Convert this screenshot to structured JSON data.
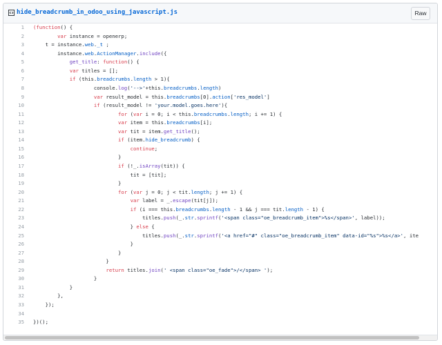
{
  "file": {
    "name": "hide_breadcrumb_in_odoo_using_javascript.js",
    "raw_label": "Raw",
    "icon": "code-file-icon"
  },
  "colors": {
    "keyword": "#d73a49",
    "string": "#032f62",
    "function": "#6f42c1",
    "property": "#005cc5",
    "line_number": "#959da5"
  },
  "lines": [
    {
      "n": "1",
      "tokens": [
        [
          "k",
          "(function"
        ],
        [
          "",
          "() {"
        ]
      ]
    },
    {
      "n": "2",
      "tokens": [
        [
          "",
          "        "
        ],
        [
          "k",
          "var"
        ],
        [
          "",
          " instance = openerp;"
        ]
      ]
    },
    {
      "n": "3",
      "tokens": [
        [
          "",
          "    t = instance."
        ],
        [
          "p",
          "web"
        ],
        [
          "",
          "."
        ],
        [
          "p",
          "_t"
        ],
        [
          "",
          " ;"
        ]
      ]
    },
    {
      "n": "4",
      "tokens": [
        [
          "",
          "        instance."
        ],
        [
          "p",
          "web"
        ],
        [
          "",
          "."
        ],
        [
          "p",
          "ActionManager"
        ],
        [
          "",
          "."
        ],
        [
          "f",
          "include"
        ],
        [
          "",
          "({"
        ]
      ]
    },
    {
      "n": "5",
      "tokens": [
        [
          "",
          "            "
        ],
        [
          "f",
          "get_title"
        ],
        [
          "",
          ": "
        ],
        [
          "k",
          "function"
        ],
        [
          "",
          "() {"
        ]
      ]
    },
    {
      "n": "6",
      "tokens": [
        [
          "",
          "            "
        ],
        [
          "k",
          "var"
        ],
        [
          "",
          " titles = [];"
        ]
      ]
    },
    {
      "n": "7",
      "tokens": [
        [
          "",
          "            "
        ],
        [
          "k",
          "if"
        ],
        [
          "",
          " (this."
        ],
        [
          "p",
          "breadcrumbs"
        ],
        [
          "",
          "."
        ],
        [
          "p",
          "length"
        ],
        [
          "",
          " > 1){"
        ]
      ]
    },
    {
      "n": "8",
      "tokens": [
        [
          "",
          "                    console."
        ],
        [
          "f",
          "log"
        ],
        [
          "",
          "("
        ],
        [
          "s",
          "'-->'"
        ],
        [
          "",
          "+this."
        ],
        [
          "p",
          "breadcrumbs"
        ],
        [
          "",
          "."
        ],
        [
          "p",
          "length"
        ],
        [
          "",
          ")"
        ]
      ]
    },
    {
      "n": "9",
      "tokens": [
        [
          "",
          "                    "
        ],
        [
          "k",
          "var"
        ],
        [
          "",
          " result_model = this."
        ],
        [
          "p",
          "breadcrumbs"
        ],
        [
          "",
          "[0]."
        ],
        [
          "p",
          "action"
        ],
        [
          "",
          "["
        ],
        [
          "s",
          "'res_model'"
        ],
        [
          "",
          "]"
        ]
      ]
    },
    {
      "n": "10",
      "tokens": [
        [
          "",
          "                    "
        ],
        [
          "k",
          "if"
        ],
        [
          "",
          " (result_model != "
        ],
        [
          "s",
          "'your.model.goes.here'"
        ],
        [
          "",
          "){"
        ]
      ]
    },
    {
      "n": "11",
      "tokens": [
        [
          "",
          "                            "
        ],
        [
          "k",
          "for"
        ],
        [
          "",
          " ("
        ],
        [
          "k",
          "var"
        ],
        [
          "",
          " i = 0; i < this."
        ],
        [
          "p",
          "breadcrumbs"
        ],
        [
          "",
          "."
        ],
        [
          "p",
          "length"
        ],
        [
          "",
          "; i += 1) {"
        ]
      ]
    },
    {
      "n": "12",
      "tokens": [
        [
          "",
          "                            "
        ],
        [
          "k",
          "var"
        ],
        [
          "",
          " item = this."
        ],
        [
          "p",
          "breadcrumbs"
        ],
        [
          "",
          "[i];"
        ]
      ]
    },
    {
      "n": "13",
      "tokens": [
        [
          "",
          "                            "
        ],
        [
          "k",
          "var"
        ],
        [
          "",
          " tit = item."
        ],
        [
          "f",
          "get_title"
        ],
        [
          "",
          "();"
        ]
      ]
    },
    {
      "n": "14",
      "tokens": [
        [
          "",
          "                            "
        ],
        [
          "k",
          "if"
        ],
        [
          "",
          " (item."
        ],
        [
          "p",
          "hide_breadcrumb"
        ],
        [
          "",
          ") {"
        ]
      ]
    },
    {
      "n": "15",
      "tokens": [
        [
          "",
          "                                "
        ],
        [
          "k",
          "continue"
        ],
        [
          "",
          ";"
        ]
      ]
    },
    {
      "n": "16",
      "tokens": [
        [
          "",
          "                            }"
        ]
      ]
    },
    {
      "n": "17",
      "tokens": [
        [
          "",
          "                            "
        ],
        [
          "k",
          "if"
        ],
        [
          "",
          " (!_."
        ],
        [
          "f",
          "isArray"
        ],
        [
          "",
          "(tit)) {"
        ]
      ]
    },
    {
      "n": "18",
      "tokens": [
        [
          "",
          "                                tit = [tit];"
        ]
      ]
    },
    {
      "n": "19",
      "tokens": [
        [
          "",
          "                            }"
        ]
      ]
    },
    {
      "n": "20",
      "tokens": [
        [
          "",
          "                            "
        ],
        [
          "k",
          "for"
        ],
        [
          "",
          " ("
        ],
        [
          "k",
          "var"
        ],
        [
          "",
          " j = 0; j < tit."
        ],
        [
          "p",
          "length"
        ],
        [
          "",
          "; j += 1) {"
        ]
      ]
    },
    {
      "n": "21",
      "tokens": [
        [
          "",
          "                                "
        ],
        [
          "k",
          "var"
        ],
        [
          "",
          " label = _."
        ],
        [
          "f",
          "escape"
        ],
        [
          "",
          "(tit[j]);"
        ]
      ]
    },
    {
      "n": "22",
      "tokens": [
        [
          "",
          "                                "
        ],
        [
          "k",
          "if"
        ],
        [
          "",
          " (i === this."
        ],
        [
          "p",
          "breadcrumbs"
        ],
        [
          "",
          "."
        ],
        [
          "p",
          "length"
        ],
        [
          "",
          " - 1 && j === tit."
        ],
        [
          "p",
          "length"
        ],
        [
          "",
          " - 1) {"
        ]
      ]
    },
    {
      "n": "23",
      "tokens": [
        [
          "",
          "                                    titles."
        ],
        [
          "f",
          "push"
        ],
        [
          "",
          "(_."
        ],
        [
          "p",
          "str"
        ],
        [
          "",
          "."
        ],
        [
          "f",
          "sprintf"
        ],
        [
          "",
          "("
        ],
        [
          "s",
          "'<span class=\"oe_breadcrumb_item\">%s</span>'"
        ],
        [
          "",
          ", label));"
        ]
      ]
    },
    {
      "n": "24",
      "tokens": [
        [
          "",
          "                                } "
        ],
        [
          "k",
          "else"
        ],
        [
          "",
          " {"
        ]
      ]
    },
    {
      "n": "25",
      "tokens": [
        [
          "",
          "                                    titles."
        ],
        [
          "f",
          "push"
        ],
        [
          "",
          "(_."
        ],
        [
          "p",
          "str"
        ],
        [
          "",
          "."
        ],
        [
          "f",
          "sprintf"
        ],
        [
          "",
          "("
        ],
        [
          "s",
          "'<a href=\"#\" class=\"oe_breadcrumb_item\" data-id=\"%s\">%s</a>'"
        ],
        [
          "",
          ", ite"
        ]
      ]
    },
    {
      "n": "26",
      "tokens": [
        [
          "",
          "                                }"
        ]
      ]
    },
    {
      "n": "27",
      "tokens": [
        [
          "",
          "                            }"
        ]
      ]
    },
    {
      "n": "28",
      "tokens": [
        [
          "",
          "                        }"
        ]
      ]
    },
    {
      "n": "29",
      "tokens": [
        [
          "",
          "                        "
        ],
        [
          "k",
          "return"
        ],
        [
          "",
          " titles."
        ],
        [
          "f",
          "join"
        ],
        [
          "",
          "("
        ],
        [
          "s",
          "' <span class=\"oe_fade\">/</span> '"
        ],
        [
          "",
          ");"
        ]
      ]
    },
    {
      "n": "30",
      "tokens": [
        [
          "",
          "                    }"
        ]
      ]
    },
    {
      "n": "31",
      "tokens": [
        [
          "",
          "            }"
        ]
      ]
    },
    {
      "n": "32",
      "tokens": [
        [
          "",
          "        },"
        ]
      ]
    },
    {
      "n": "33",
      "tokens": [
        [
          "",
          "    });"
        ]
      ]
    },
    {
      "n": "34",
      "tokens": []
    },
    {
      "n": "35",
      "tokens": [
        [
          "",
          "})();"
        ]
      ]
    }
  ]
}
